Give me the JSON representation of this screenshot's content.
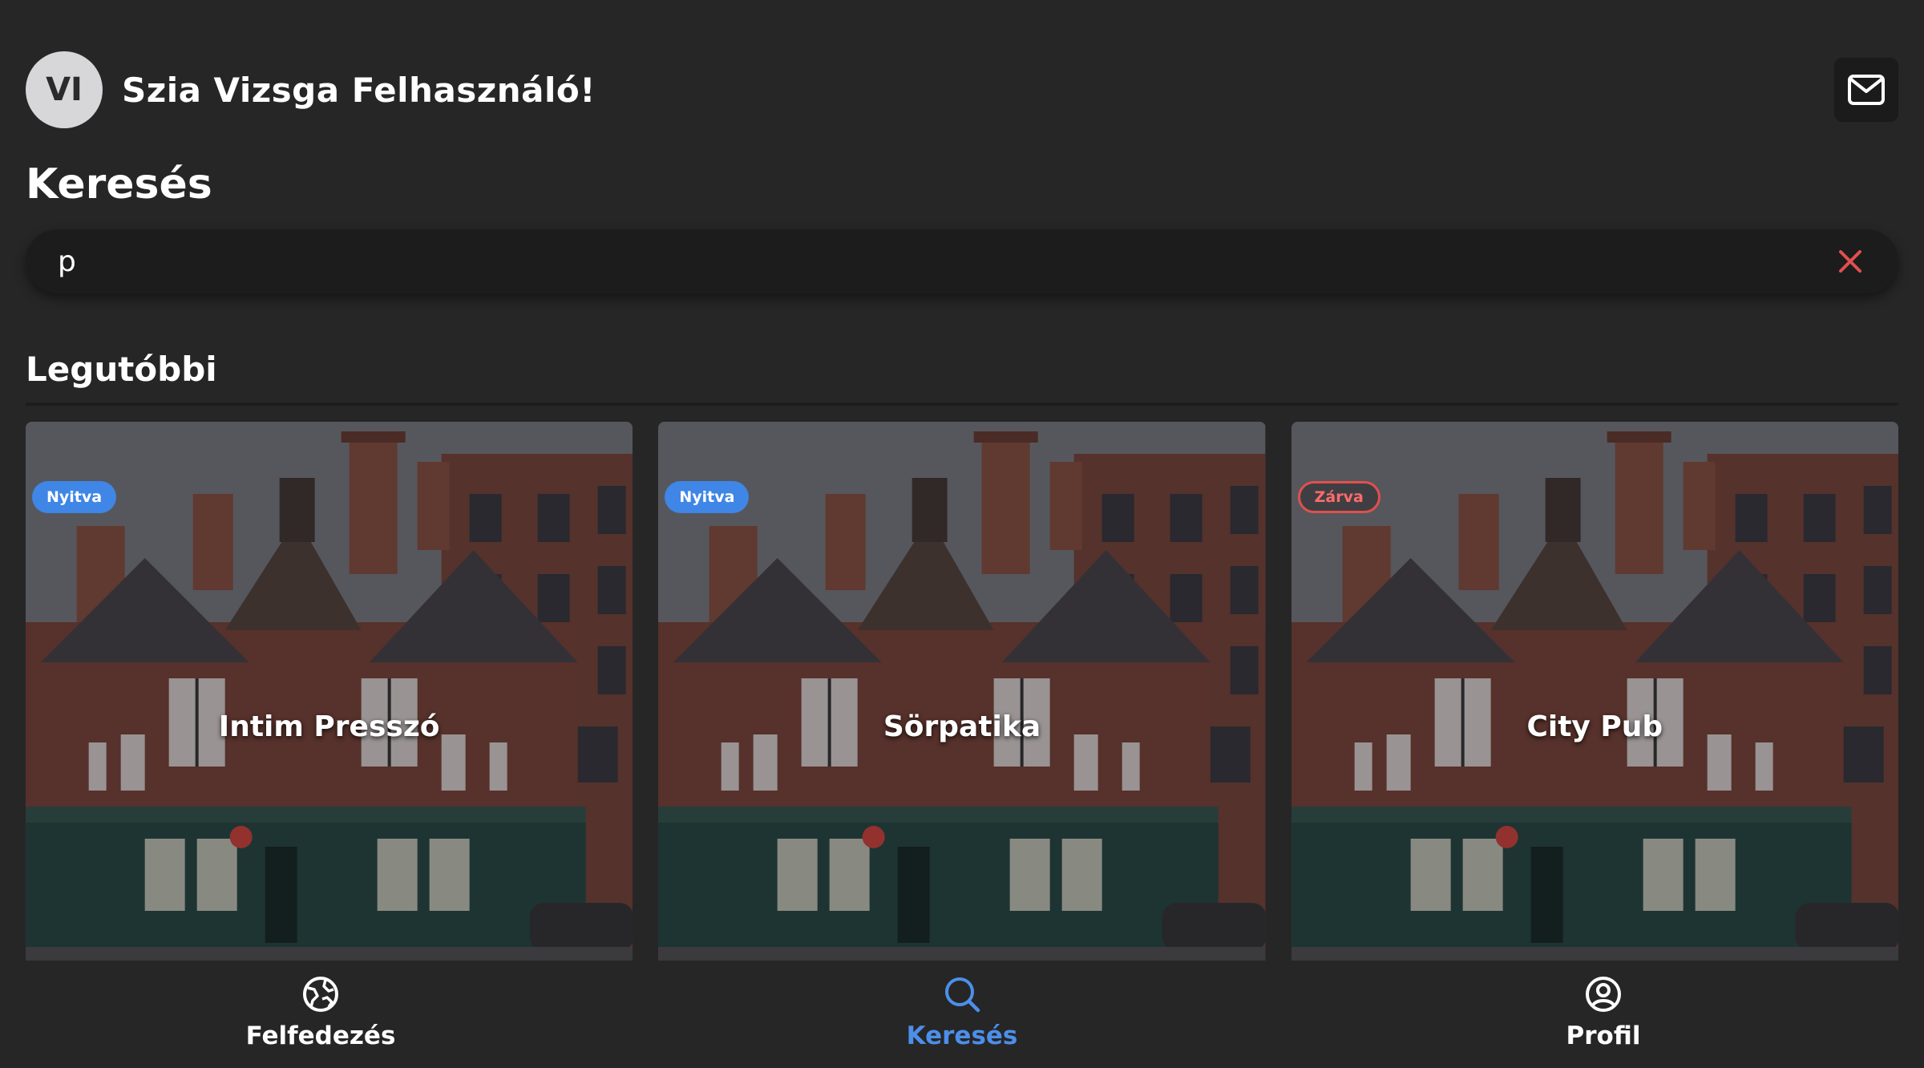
{
  "header": {
    "avatar_initials": "VI",
    "greeting": "Szia Vizsga Felhasználó!",
    "mail_icon": "mail-icon"
  },
  "page_title": "Keresés",
  "search": {
    "value": "p",
    "placeholder": "",
    "clear_icon": "close-icon",
    "clear_color": "#e0504d"
  },
  "recent": {
    "title": "Legutóbbi",
    "cards": [
      {
        "name": "Intim Presszó",
        "status": "Nyitva",
        "status_type": "open"
      },
      {
        "name": "Sörpatika",
        "status": "Nyitva",
        "status_type": "open"
      },
      {
        "name": "City Pub",
        "status": "Zárva",
        "status_type": "closed"
      }
    ]
  },
  "nav": {
    "items": [
      {
        "label": "Felfedezés",
        "icon": "explore-globe-icon",
        "active": false
      },
      {
        "label": "Keresés",
        "icon": "search-icon",
        "active": true
      },
      {
        "label": "Profil",
        "icon": "profile-user-icon",
        "active": false
      }
    ],
    "active_color": "#4c8fe8"
  },
  "colors": {
    "background": "#262627",
    "open_badge": "#3f86e6",
    "closed_badge": "#e0504d"
  }
}
